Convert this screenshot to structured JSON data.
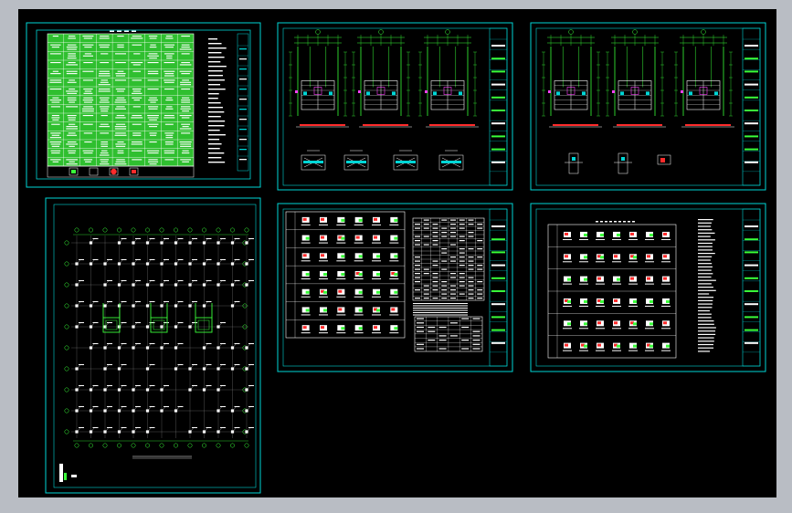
{
  "window": {
    "background": "#b9bdc4",
    "canvas_background": "#000000"
  },
  "colors": {
    "frame": "#00d6d6",
    "table_fill": "#2fbf2f",
    "line_green": "#39ff39",
    "white": "#ffffff",
    "red": "#ff2b2b",
    "magenta": "#ff40ff"
  },
  "sheets": [
    {
      "id": "sheet-1",
      "kind": "schedule-table",
      "title": "",
      "table_rows": 15,
      "table_cols": 9
    },
    {
      "id": "sheet-2",
      "kind": "stair-plans",
      "plan_count": 3,
      "section_count": 4
    },
    {
      "id": "sheet-3",
      "kind": "stair-plans",
      "plan_count": 3,
      "section_count": 3
    },
    {
      "id": "sheet-4",
      "kind": "column-layout-plan",
      "caption": ""
    },
    {
      "id": "sheet-5",
      "kind": "detail-grid",
      "detail_rows": 7,
      "detail_cols": 6
    },
    {
      "id": "sheet-6",
      "kind": "detail-grid",
      "detail_rows": 6,
      "detail_cols": 7
    }
  ]
}
